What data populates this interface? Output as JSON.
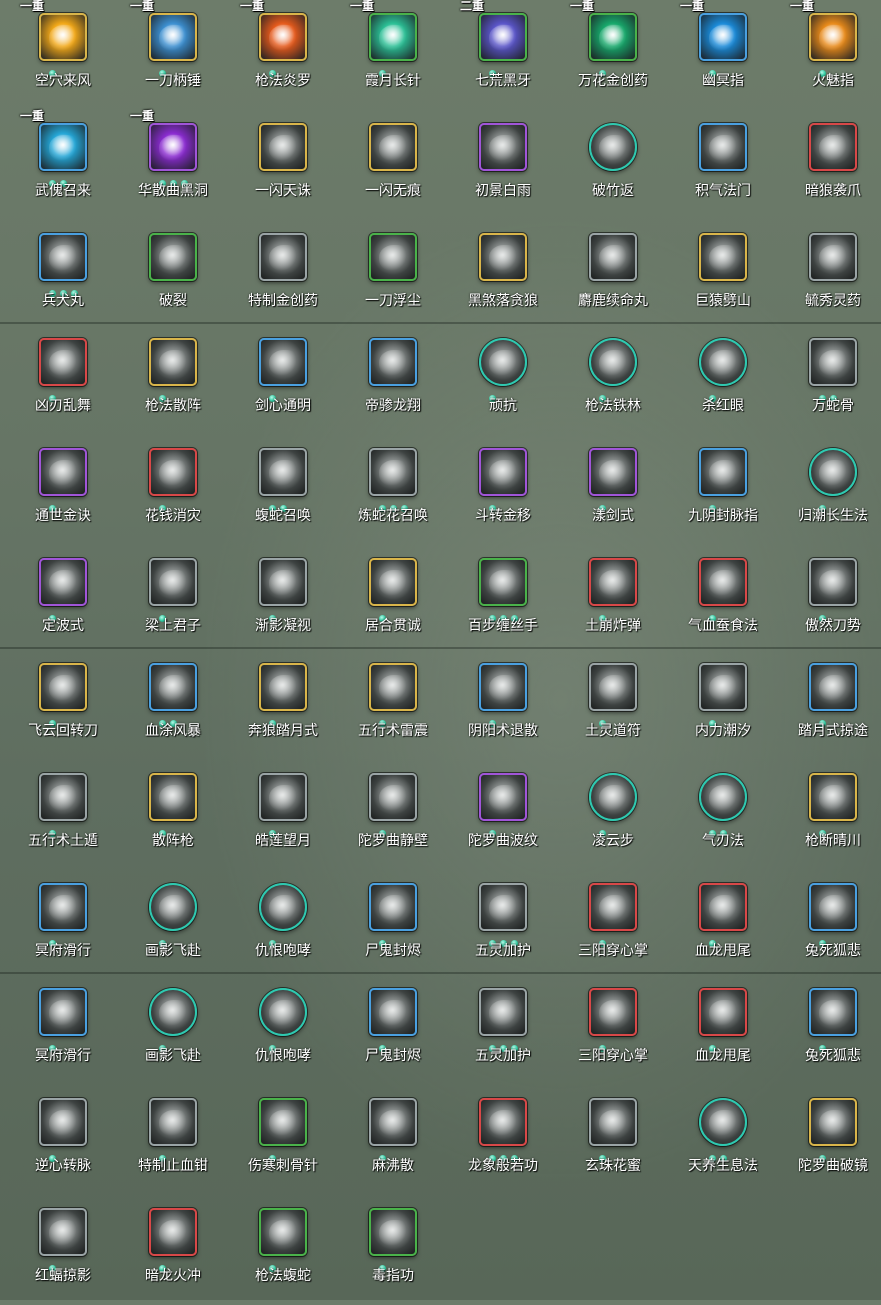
{
  "rows": [
    [
      {
        "label": "空穴来风",
        "frame": "#d9b54a",
        "badge": "一重",
        "dots": 1,
        "color": "#f2a818"
      },
      {
        "label": "一刀柄锤",
        "frame": "#d9b54a",
        "badge": "一重",
        "dots": 1,
        "color": "#3c8fd0"
      },
      {
        "label": "枪法炎罗",
        "frame": "#d9b54a",
        "badge": "一重",
        "dots": 1,
        "color": "#e55a1c"
      },
      {
        "label": "霞月长针",
        "frame": "#4ab24a",
        "badge": "一重",
        "dots": 1,
        "color": "#2bbf95"
      },
      {
        "label": "七荒黑牙",
        "frame": "#4ab24a",
        "badge": "二重",
        "dots": 1,
        "color": "#5a55c8"
      },
      {
        "label": "万花金创药",
        "frame": "#4ab24a",
        "badge": "一重",
        "dots": 1,
        "color": "#17a86b"
      },
      {
        "label": "幽冥指",
        "frame": "#4aa0e0",
        "badge": "一重",
        "dots": 1,
        "color": "#1a8ad8"
      },
      {
        "label": "火魅指",
        "frame": "#d9b54a",
        "badge": "一重",
        "dots": 1,
        "color": "#e88a1a"
      }
    ],
    [
      {
        "label": "武傀召来",
        "frame": "#4aa0e0",
        "badge": "一重",
        "dots": 2,
        "color": "#24a6d6"
      },
      {
        "label": "华散曲黑洞",
        "frame": "#a055d8",
        "badge": "一重",
        "dots": 3,
        "color": "#8a2bd0"
      },
      {
        "label": "一闪天诛",
        "frame": "#d9b54a",
        "badge": "",
        "dots": 0,
        "color": "#8d918f"
      },
      {
        "label": "一闪无痕",
        "frame": "#d9b54a",
        "badge": "",
        "dots": 0,
        "color": "#8d918f"
      },
      {
        "label": "初景白雨",
        "frame": "#a055d8",
        "badge": "",
        "dots": 0,
        "color": "#8d918f"
      },
      {
        "label": "破竹返",
        "frame": "#2ec9b0",
        "badge": "",
        "dots": 0,
        "color": "#8d918f",
        "round": true
      },
      {
        "label": "积气法门",
        "frame": "#4aa0e0",
        "badge": "",
        "dots": 0,
        "color": "#8d918f"
      },
      {
        "label": "暗狼袭爪",
        "frame": "#d84848",
        "badge": "",
        "dots": 0,
        "color": "#8d918f"
      }
    ],
    [
      {
        "label": "兵犬丸",
        "frame": "#4aa0e0",
        "badge": "",
        "dots": 3,
        "color": "#8d918f"
      },
      {
        "label": "破裂",
        "frame": "#4ab24a",
        "badge": "",
        "dots": 0,
        "color": "#8d918f"
      },
      {
        "label": "特制金创药",
        "frame": "#9aa4a6",
        "badge": "",
        "dots": 0,
        "color": "#8d918f"
      },
      {
        "label": "一刀浮尘",
        "frame": "#4ab24a",
        "badge": "",
        "dots": 0,
        "color": "#8d918f"
      },
      {
        "label": "黑煞落贪狼",
        "frame": "#d9b54a",
        "badge": "",
        "dots": 0,
        "color": "#8d918f"
      },
      {
        "label": "麝鹿续命丸",
        "frame": "#9aa4a6",
        "badge": "",
        "dots": 0,
        "color": "#8d918f"
      },
      {
        "label": "巨猿劈山",
        "frame": "#d9b54a",
        "badge": "",
        "dots": 0,
        "color": "#8d918f"
      },
      {
        "label": "毓秀灵药",
        "frame": "#9aa4a6",
        "badge": "",
        "dots": 0,
        "color": "#8d918f"
      }
    ],
    [
      {
        "label": "凶刃乱舞",
        "frame": "#d84848",
        "badge": "",
        "dots": 1,
        "color": "#8d918f"
      },
      {
        "label": "枪法散阵",
        "frame": "#d9b54a",
        "badge": "",
        "dots": 1,
        "color": "#8d918f"
      },
      {
        "label": "剑心通明",
        "frame": "#4aa0e0",
        "badge": "",
        "dots": 1,
        "color": "#8d918f"
      },
      {
        "label": "帝骖龙翔",
        "frame": "#4aa0e0",
        "badge": "",
        "dots": 0,
        "color": "#8d918f"
      },
      {
        "label": "顽抗",
        "frame": "#2ec9b0",
        "badge": "",
        "dots": 1,
        "color": "#8d918f",
        "round": true
      },
      {
        "label": "枪法铁林",
        "frame": "#2ec9b0",
        "badge": "",
        "dots": 1,
        "color": "#8d918f",
        "round": true
      },
      {
        "label": "杀红眼",
        "frame": "#2ec9b0",
        "badge": "",
        "dots": 1,
        "color": "#8d918f",
        "round": true
      },
      {
        "label": "万蛇骨",
        "frame": "#9aa4a6",
        "badge": "",
        "dots": 2,
        "color": "#8d918f"
      }
    ],
    [
      {
        "label": "通世金诀",
        "frame": "#a055d8",
        "badge": "",
        "dots": 1,
        "color": "#8d918f"
      },
      {
        "label": "花钱消灾",
        "frame": "#d84848",
        "badge": "",
        "dots": 1,
        "color": "#8d918f"
      },
      {
        "label": "蝮蛇召唤",
        "frame": "#9aa4a6",
        "badge": "",
        "dots": 2,
        "color": "#8d918f"
      },
      {
        "label": "炼蛇花召唤",
        "frame": "#9aa4a6",
        "badge": "",
        "dots": 3,
        "color": "#8d918f"
      },
      {
        "label": "斗转金移",
        "frame": "#a055d8",
        "badge": "",
        "dots": 1,
        "color": "#8d918f"
      },
      {
        "label": "漾剑式",
        "frame": "#a055d8",
        "badge": "",
        "dots": 1,
        "color": "#8d918f"
      },
      {
        "label": "九阴封脉指",
        "frame": "#4aa0e0",
        "badge": "",
        "dots": 1,
        "color": "#8d918f"
      },
      {
        "label": "归潮长生法",
        "frame": "#2ec9b0",
        "badge": "",
        "dots": 1,
        "color": "#8d918f",
        "round": true
      }
    ],
    [
      {
        "label": "定波式",
        "frame": "#a055d8",
        "badge": "",
        "dots": 1,
        "color": "#8d918f"
      },
      {
        "label": "梁上君子",
        "frame": "#9aa4a6",
        "badge": "",
        "dots": 1,
        "color": "#8d918f"
      },
      {
        "label": "渐影凝视",
        "frame": "#9aa4a6",
        "badge": "",
        "dots": 1,
        "color": "#8d918f"
      },
      {
        "label": "居合贯诚",
        "frame": "#d9b54a",
        "badge": "",
        "dots": 1,
        "color": "#8d918f"
      },
      {
        "label": "百步缠丝手",
        "frame": "#4ab24a",
        "badge": "",
        "dots": 3,
        "color": "#8d918f"
      },
      {
        "label": "土崩炸弹",
        "frame": "#d84848",
        "badge": "",
        "dots": 1,
        "color": "#8d918f"
      },
      {
        "label": "气血蚕食法",
        "frame": "#d84848",
        "badge": "",
        "dots": 1,
        "color": "#8d918f"
      },
      {
        "label": "傲然刀势",
        "frame": "#9aa4a6",
        "badge": "",
        "dots": 1,
        "color": "#8d918f"
      }
    ],
    [
      {
        "label": "飞云回转刀",
        "frame": "#d9b54a",
        "badge": "",
        "dots": 1,
        "color": "#8d918f"
      },
      {
        "label": "血涂风暴",
        "frame": "#4aa0e0",
        "badge": "",
        "dots": 2,
        "color": "#8d918f"
      },
      {
        "label": "奔狼踏月式",
        "frame": "#d9b54a",
        "badge": "",
        "dots": 1,
        "color": "#8d918f"
      },
      {
        "label": "五行术雷震",
        "frame": "#d9b54a",
        "badge": "",
        "dots": 1,
        "color": "#8d918f"
      },
      {
        "label": "阴阳术退散",
        "frame": "#4aa0e0",
        "badge": "",
        "dots": 1,
        "color": "#8d918f"
      },
      {
        "label": "土灵道符",
        "frame": "#9aa4a6",
        "badge": "",
        "dots": 1,
        "color": "#8d918f"
      },
      {
        "label": "内力潮汐",
        "frame": "#9aa4a6",
        "badge": "",
        "dots": 1,
        "color": "#8d918f"
      },
      {
        "label": "踏月式掠途",
        "frame": "#4aa0e0",
        "badge": "",
        "dots": 1,
        "color": "#8d918f"
      }
    ],
    [
      {
        "label": "五行术土遁",
        "frame": "#9aa4a6",
        "badge": "",
        "dots": 1,
        "color": "#8d918f"
      },
      {
        "label": "散阵枪",
        "frame": "#d9b54a",
        "badge": "",
        "dots": 1,
        "color": "#8d918f"
      },
      {
        "label": "皓莲望月",
        "frame": "#9aa4a6",
        "badge": "",
        "dots": 1,
        "color": "#8d918f"
      },
      {
        "label": "陀罗曲静壁",
        "frame": "#9aa4a6",
        "badge": "",
        "dots": 1,
        "color": "#8d918f"
      },
      {
        "label": "陀罗曲波纹",
        "frame": "#a055d8",
        "badge": "",
        "dots": 1,
        "color": "#8d918f"
      },
      {
        "label": "凌云步",
        "frame": "#2ec9b0",
        "badge": "",
        "dots": 1,
        "color": "#8d918f",
        "round": true
      },
      {
        "label": "气刃法",
        "frame": "#2ec9b0",
        "badge": "",
        "dots": 2,
        "color": "#8d918f",
        "round": true
      },
      {
        "label": "枪断晴川",
        "frame": "#d9b54a",
        "badge": "",
        "dots": 1,
        "color": "#8d918f"
      }
    ],
    [
      {
        "label": "冥府滑行",
        "frame": "#4aa0e0",
        "badge": "",
        "dots": 1,
        "color": "#8d918f"
      },
      {
        "label": "画影飞赴",
        "frame": "#2ec9b0",
        "badge": "",
        "dots": 1,
        "color": "#8d918f",
        "round": true
      },
      {
        "label": "仇恨咆哮",
        "frame": "#2ec9b0",
        "badge": "",
        "dots": 1,
        "color": "#8d918f",
        "round": true
      },
      {
        "label": "尸鬼封烬",
        "frame": "#4aa0e0",
        "badge": "",
        "dots": 1,
        "color": "#8d918f"
      },
      {
        "label": "五灵加护",
        "frame": "#9aa4a6",
        "badge": "",
        "dots": 3,
        "color": "#8d918f"
      },
      {
        "label": "三阳穿心掌",
        "frame": "#d84848",
        "badge": "",
        "dots": 1,
        "color": "#8d918f"
      },
      {
        "label": "血龙甩尾",
        "frame": "#d84848",
        "badge": "",
        "dots": 1,
        "color": "#8d918f"
      },
      {
        "label": "兔死狐悲",
        "frame": "#4aa0e0",
        "badge": "",
        "dots": 1,
        "color": "#8d918f"
      }
    ],
    [
      {
        "label": "冥府滑行",
        "frame": "#4aa0e0",
        "badge": "",
        "dots": 1,
        "color": "#8d918f"
      },
      {
        "label": "画影飞赴",
        "frame": "#2ec9b0",
        "badge": "",
        "dots": 1,
        "color": "#8d918f",
        "round": true
      },
      {
        "label": "仇恨咆哮",
        "frame": "#2ec9b0",
        "badge": "",
        "dots": 1,
        "color": "#8d918f",
        "round": true
      },
      {
        "label": "尸鬼封烬",
        "frame": "#4aa0e0",
        "badge": "",
        "dots": 1,
        "color": "#8d918f"
      },
      {
        "label": "五灵加护",
        "frame": "#9aa4a6",
        "badge": "",
        "dots": 3,
        "color": "#8d918f"
      },
      {
        "label": "三阳穿心掌",
        "frame": "#d84848",
        "badge": "",
        "dots": 1,
        "color": "#8d918f"
      },
      {
        "label": "血龙甩尾",
        "frame": "#d84848",
        "badge": "",
        "dots": 1,
        "color": "#8d918f"
      },
      {
        "label": "兔死狐悲",
        "frame": "#4aa0e0",
        "badge": "",
        "dots": 1,
        "color": "#8d918f"
      }
    ],
    [
      {
        "label": "逆心转脉",
        "frame": "#9aa4a6",
        "badge": "",
        "dots": 1,
        "color": "#8d918f"
      },
      {
        "label": "特制止血钳",
        "frame": "#9aa4a6",
        "badge": "",
        "dots": 1,
        "color": "#8d918f"
      },
      {
        "label": "伤寒刺骨针",
        "frame": "#4ab24a",
        "badge": "",
        "dots": 1,
        "color": "#8d918f"
      },
      {
        "label": "麻沸散",
        "frame": "#9aa4a6",
        "badge": "",
        "dots": 1,
        "color": "#8d918f"
      },
      {
        "label": "龙象般若功",
        "frame": "#d84848",
        "badge": "",
        "dots": 3,
        "color": "#8d918f"
      },
      {
        "label": "玄珠花蜜",
        "frame": "#9aa4a6",
        "badge": "",
        "dots": 1,
        "color": "#8d918f"
      },
      {
        "label": "天养生息法",
        "frame": "#2ec9b0",
        "badge": "",
        "dots": 2,
        "color": "#8d918f",
        "round": true
      },
      {
        "label": "陀罗曲破镜",
        "frame": "#d9b54a",
        "badge": "",
        "dots": 1,
        "color": "#8d918f"
      }
    ],
    [
      {
        "label": "红蝠掠影",
        "frame": "#9aa4a6",
        "badge": "",
        "dots": 1,
        "color": "#8d918f"
      },
      {
        "label": "暗龙火冲",
        "frame": "#d84848",
        "badge": "",
        "dots": 1,
        "color": "#8d918f"
      },
      {
        "label": "枪法蝮蛇",
        "frame": "#4ab24a",
        "badge": "",
        "dots": 1,
        "color": "#8d918f"
      },
      {
        "label": "毒指功",
        "frame": "#4ab24a",
        "badge": "",
        "dots": 1,
        "color": "#8d918f"
      }
    ]
  ]
}
